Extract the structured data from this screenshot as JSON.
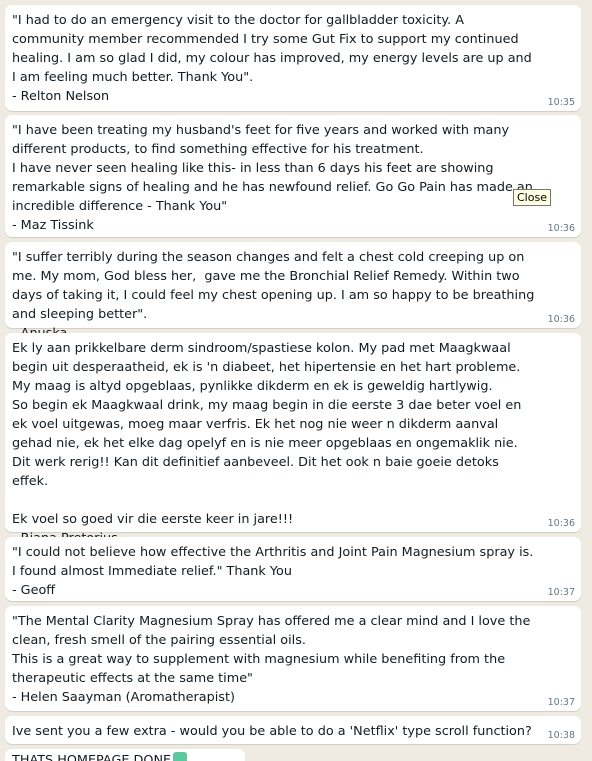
{
  "messages": [
    {
      "text": "\"I had to do an emergency visit to the doctor for gallbladder toxicity. A community member recommended I try some Gut Fix to support my continued healing. I am so glad I did, my colour has improved, my energy levels are up and I am feeling much better. Thank You\".\n- Relton Nelson",
      "time": "10:35"
    },
    {
      "text": "\"I have been treating my husband's feet for five years and worked with many different products, to find something effective for his treatment.\nI have never seen healing like this- in less than 6 days his feet are showing remarkable signs of healing and he has newfound relief. Go Go Pain has made an incredible difference - Thank You\"\n- Maz Tissink",
      "time": "10:36"
    },
    {
      "text": "\"I suffer terribly during the season changes and felt a chest cold creeping up on me. My mom, God bless her,  gave me the Bronchial Relief Remedy. Within two days of taking it, I could feel my chest opening up. I am so happy to be breathing and sleeping better\".\n- Anuska",
      "time": "10:36"
    },
    {
      "text": "Ek ly aan prikkelbare derm sindroom/spastiese kolon. My pad met Maagkwaal begin uit desperaatheid, ek is 'n diabeet, het hipertensie en het hart probleme. My maag is altyd opgeblaas, pynlikke dikderm en ek is geweldig hartlywig.\nSo begin ek Maagkwaal drink, my maag begin in die eerste 3 dae beter voel en ek voel uitgewas, moeg maar verfris. Ek het nog nie weer n dikderm aanval gehad nie, ek het elke dag opelyf en is nie meer opgeblaas en ongemaklik nie. Dit werk rerig!! Kan dit definitief aanbeveel. Dit het ook n baie goeie detoks effek.\n\nEk voel so goed vir die eerste keer in jare!!!\n- Riana Pretorius",
      "time": "10:36"
    },
    {
      "text": "\"I could not believe how effective the Arthritis and Joint Pain Magnesium spray is. I found almost Immediate relief.\" Thank You\n- Geoff",
      "time": "10:37"
    },
    {
      "text": "\"The Mental Clarity Magnesium Spray has offered me a clear mind and I love the clean, fresh smell of the pairing essential oils.\nThis is a great way to supplement with magnesium while benefiting from the therapeutic effects at the same time\"\n- Helen Saayman (Aromatherapist)",
      "time": "10:37"
    },
    {
      "text": "Ive sent you a few extra - would you be able to do a 'Netflix' type scroll function?",
      "time": "10:38"
    }
  ],
  "partial_message": "THATS HOMEPAGE DONE",
  "tooltip": "Close"
}
